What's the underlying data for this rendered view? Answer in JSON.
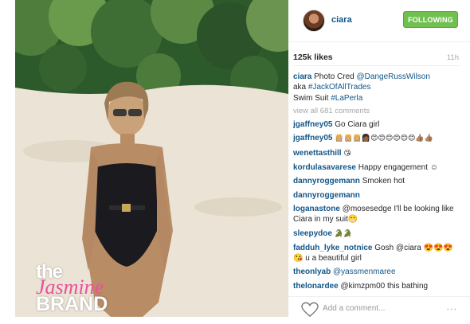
{
  "watermark": {
    "line1": "the",
    "line2": "Jasmine",
    "line3": "BRAND"
  },
  "post": {
    "username": "ciara",
    "follow_button": "FOLLOWING",
    "likes": "125k likes",
    "time": "11h",
    "caption": {
      "user": "ciara",
      "line1": "Photo Cred ",
      "mention": "@DangeRussWilson",
      "line2": "aka ",
      "tag1": "#JackOfAllTrades",
      "line3": "Swim Suit ",
      "tag2": "#LaPerla"
    },
    "view_all": "view all 681 comments",
    "comments": [
      {
        "user": "jgaffney05",
        "text": "Go Ciara girl"
      },
      {
        "user": "jgaffney05",
        "text": "👸🏼👸🏼👸🏼👩🏾😊😊😊😊😊😊👍🏽👍🏽"
      },
      {
        "user": "wenettasthill",
        "text": "😘"
      },
      {
        "user": "kordulasavarese",
        "text": "Happy engagement ☺"
      },
      {
        "user": "dannyroggemann",
        "text": "Smoken hot"
      },
      {
        "user": "dannyroggemann",
        "text": ""
      },
      {
        "user": "loganastone",
        "text": "@mosesedge I'll be looking like Ciara in my suit😁"
      },
      {
        "user": "sleepydoe",
        "text": "🐊🐊"
      },
      {
        "user": "fadduh_lyke_notnice",
        "text": "Gosh @ciara 😍😍😍😘 u a beautiful girl"
      },
      {
        "user": "theonlyab",
        "text": "@yassmenmaree"
      },
      {
        "user": "thelonardee",
        "text": "@kimzpm00 this bathing"
      }
    ],
    "add_comment_placeholder": "Add a comment..."
  },
  "icons": {
    "heart": "heart-icon",
    "more": "more-icon"
  },
  "colors": {
    "link": "#125688",
    "follow": "#70c050",
    "muted": "#a5a7aa",
    "watermark_pink": "#ec4f9a"
  }
}
